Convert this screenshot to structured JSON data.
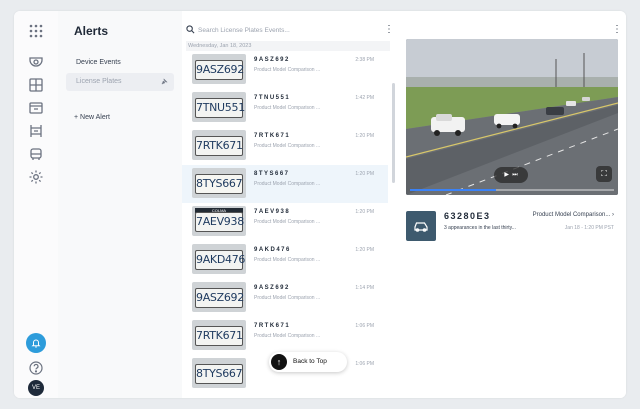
{
  "alerts": {
    "title": "Alerts",
    "nav": [
      {
        "label": "Device Events"
      },
      {
        "label": "License Plates"
      }
    ],
    "new_alert": "+ New Alert"
  },
  "events": {
    "search_placeholder": "Search License Plates Events...",
    "date_header": "Wednesday, Jan 18, 2023",
    "back_to_top": "Back to Top",
    "rows": [
      {
        "plate": "9ASZ692",
        "plate_img": "9ASZ692",
        "desc": "Product Model Comparison ...",
        "time": "2:38 PM"
      },
      {
        "plate": "7TNU551",
        "plate_img": "7TNU551",
        "desc": "Product Model Comparison ...",
        "time": "1:42 PM"
      },
      {
        "plate": "7RTK671",
        "plate_img": "7RTK671",
        "desc": "Product Model Comparison ...",
        "time": "1:20 PM"
      },
      {
        "plate": "8TYS667",
        "plate_img": "8TYS667",
        "desc": "Product Model Comparison ...",
        "time": "1:20 PM"
      },
      {
        "plate": "7AEV938",
        "plate_img": "7AEV938",
        "desc": "Product Model Comparison ...",
        "time": "1:20 PM",
        "strip": "COLMA"
      },
      {
        "plate": "9AKD476",
        "plate_img": "9AKD476",
        "desc": "Product Model Comparison ...",
        "time": "1:20 PM"
      },
      {
        "plate": "9ASZ692",
        "plate_img": "9ASZ692",
        "desc": "Product Model Comparison ...",
        "time": "1:14 PM"
      },
      {
        "plate": "7RTK671",
        "plate_img": "7RTK671",
        "desc": "Product Model Comparison ...",
        "time": "1:06 PM"
      },
      {
        "plate": "",
        "plate_img": "8TYS667",
        "desc": "",
        "time": "1:06 PM"
      }
    ]
  },
  "detail": {
    "plate": "63280E3",
    "subtitle": "3 appearances in the last thirty...",
    "model": "Product Model Comparison...",
    "chevron": "›",
    "date": "Jan 18 - 1:20 PM PST",
    "video_progress": 0.42
  },
  "user": {
    "initials": "VE"
  },
  "colors": {
    "accent": "#2d9cdb",
    "selected_row": "#eef5fb",
    "vehicle_badge": "#3e5a6e"
  }
}
